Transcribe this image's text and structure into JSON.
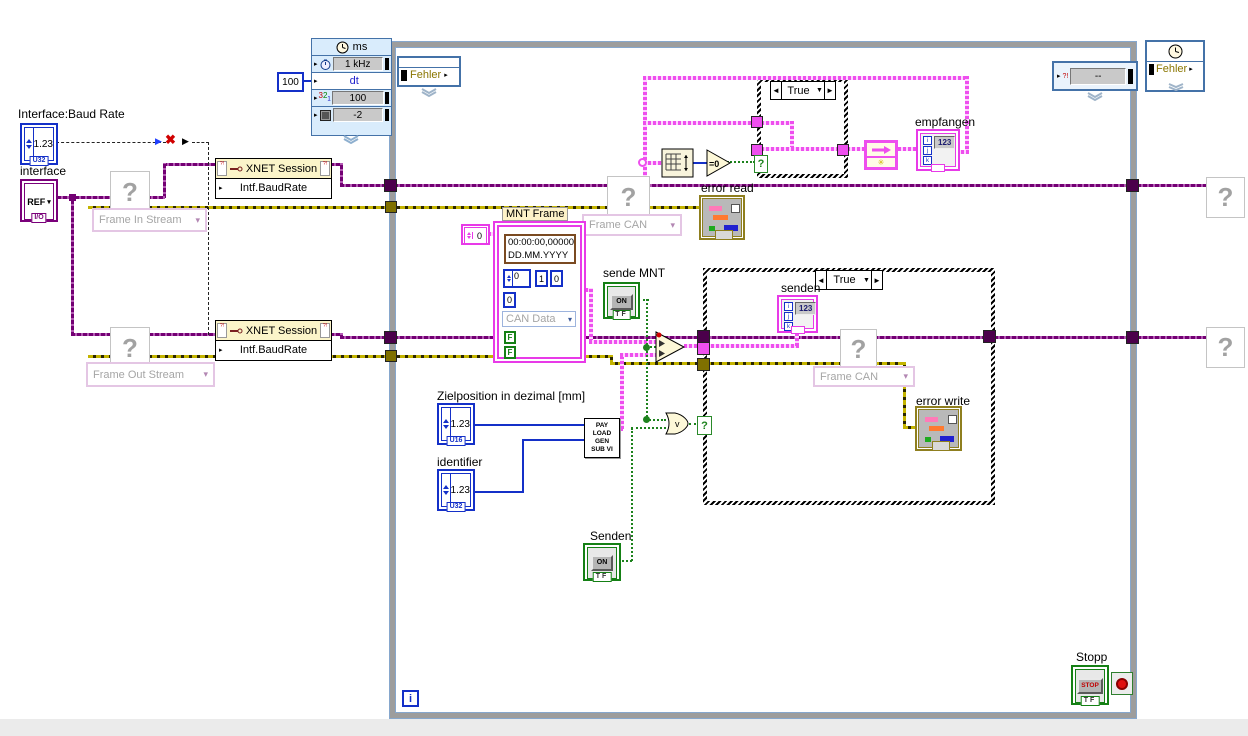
{
  "glyphs": {
    "question": "?",
    "arrow_right": "▸",
    "arrow_solid": "▶",
    "dropdown": "▼",
    "dropdown_small": "▾",
    "case_left": "◄",
    "case_right": "►",
    "asterisk": "✳",
    "broken_x": "✖",
    "i32a": "3",
    "i32b": "2",
    "i32c": "1"
  },
  "timed_loop": {
    "unit": "ms",
    "source": "1 kHz",
    "dt_label": "dt",
    "dt_constant": "100",
    "period": "100",
    "priority": "-2",
    "error_in": "Fehler",
    "error_out": "Fehler",
    "right_node_value": "--",
    "node_tag": "?!",
    "iteration": "i"
  },
  "xnet": {
    "title": "XNET Session",
    "property": "Intf.BaudRate"
  },
  "dropdowns": {
    "frame_in_stream": "Frame In Stream",
    "frame_out_stream": "Frame Out Stream",
    "frame_can_read": "Frame CAN",
    "frame_can_write": "Frame CAN",
    "can_data": "CAN Data"
  },
  "mnt_cluster": {
    "label": "MNT Frame",
    "timestamp_time": "00:00:00,00000",
    "timestamp_date": "DD.MM.YYYY",
    "num_spin": "0",
    "num_a": "1",
    "num_b": "0",
    "num_c": "0",
    "outer_index": "0",
    "bool_1": "F",
    "bool_2": "F"
  },
  "controls": {
    "baud_label": "Interface:Baud Rate",
    "baud_value": "1.23",
    "baud_type": "U32",
    "ref_label": "interface",
    "ref_value": "REF",
    "ref_type": "I/O",
    "ziel_label": "Zielposition in dezimal [mm]",
    "ziel_value": "1.23",
    "ziel_type": "U16",
    "ident_label": "identifier",
    "ident_value": "1.23",
    "ident_type": "U32",
    "sende_mnt_label": "sende MNT",
    "sende_mnt_value": "ON",
    "sende_mnt_type": "TF",
    "senden_label": "Senden",
    "senden_value": "ON",
    "senden_type": "TF",
    "stopp_label": "Stopp",
    "stopp_value": "STOP",
    "stopp_type": "TF"
  },
  "indicators": {
    "empfangen_label": "empfangen",
    "senden_label": "senden",
    "error_read_label": "error read",
    "error_write_label": "error write",
    "array_value": "123",
    "dims": [
      "i",
      "j",
      "k"
    ]
  },
  "functions": {
    "equals_zero": "=0",
    "or_symbol": "v",
    "subvi_lines": [
      "PAY",
      "LOAD",
      "GEN",
      "SUB VI"
    ]
  },
  "cases": {
    "top_selector": "True",
    "right_selector": "True"
  }
}
